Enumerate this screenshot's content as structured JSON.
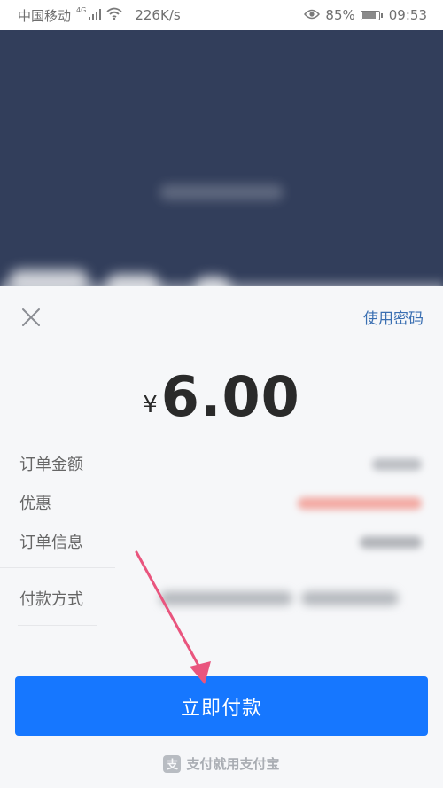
{
  "status_bar": {
    "carrier": "中国移动",
    "network": "4G",
    "speed": "226K/s",
    "battery": "85%",
    "battery_level": 0.85,
    "time": "09:53"
  },
  "sheet": {
    "use_password_label": "使用密码",
    "currency_symbol": "¥",
    "amount": "6.00",
    "rows": {
      "order_amount_label": "订单金额",
      "discount_label": "优惠",
      "order_info_label": "订单信息",
      "payment_method_label": "付款方式"
    },
    "pay_button_label": "立即付款",
    "footer_text": "支付就用支付宝"
  },
  "colors": {
    "accent": "#1677ff",
    "link": "#3a6fb2",
    "backdrop": "#323e5b",
    "discount": "#f04b3a",
    "annotation_arrow": "#e9557e"
  },
  "icons": {
    "close": "close-icon",
    "eye": "eye-icon",
    "wifi": "wifi-icon",
    "signal": "signal-icon",
    "battery": "battery-icon",
    "alipay": "alipay-logo-icon"
  }
}
